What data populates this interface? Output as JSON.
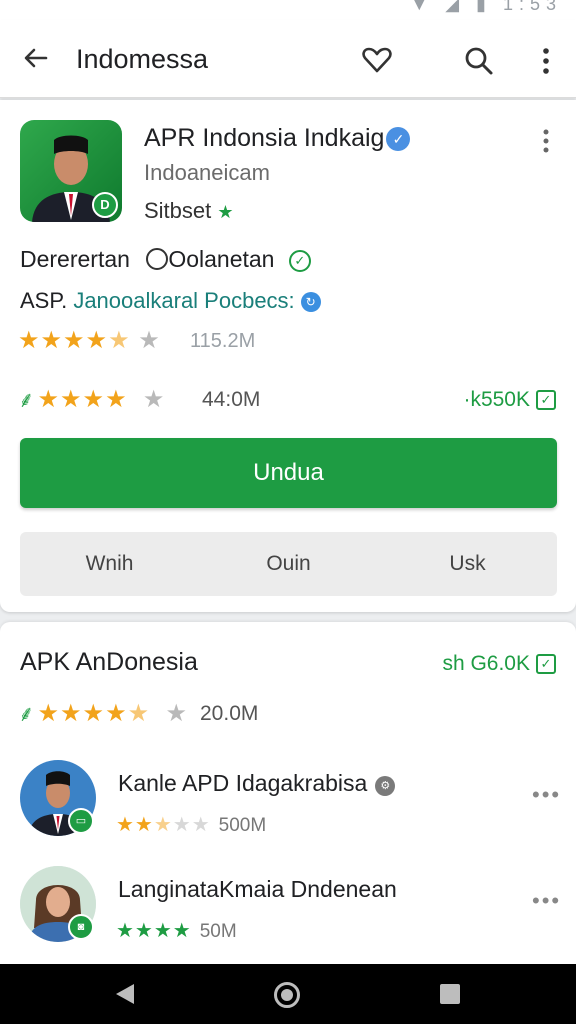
{
  "status_bar": {
    "time": "1:53"
  },
  "toolbar": {
    "title": "Indomessa",
    "icons": [
      "back-arrow-icon",
      "heart-icon",
      "search-icon",
      "more-vert-icon"
    ]
  },
  "app": {
    "title": "APR Indonsia Indkaig",
    "developer": "Indoaneicam",
    "subtitle": "Sitbset",
    "line1": "Dererertan",
    "line1_b": "Oolanetan",
    "line2_prefix": "ASP.",
    "line2_link": "Janooalkaral Pocbecs:",
    "rating1_value": "115.2M",
    "rating2_value": "44:0M",
    "stat_right": "·k550K",
    "install_label": "Undua",
    "segments": [
      "Wnih",
      "Ouin",
      "Usk"
    ]
  },
  "section": {
    "title": "APK AnDonesia",
    "stat_right": "sh G6.0K",
    "rating_value": "20.0M",
    "items": [
      {
        "title": "Kanle APD Idagakrabisa",
        "rating": 2.5,
        "value": "500M",
        "star_color": "orange"
      },
      {
        "title": "LanginataKmaia Dndenean",
        "rating": 4,
        "value": "50M",
        "star_color": "green"
      }
    ]
  },
  "colors": {
    "accent": "#1e9c43",
    "star": "#f2a31b",
    "verify": "#4a90e2"
  }
}
